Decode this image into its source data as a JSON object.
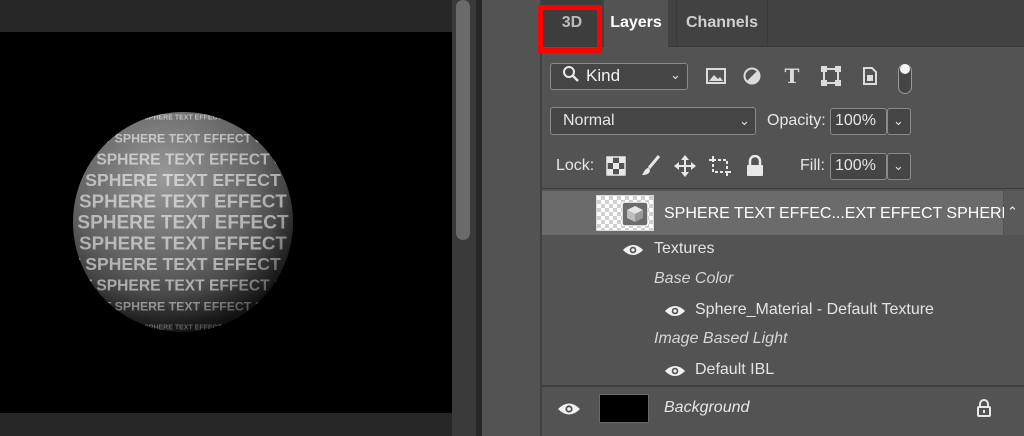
{
  "tabs": [
    {
      "label": "3D"
    },
    {
      "label": "Layers"
    },
    {
      "label": "Channels"
    }
  ],
  "highlight_color": "#ff0000",
  "filter": {
    "kind_label": "Kind",
    "icons": [
      "search-icon",
      "image-filter-icon",
      "adjustment-filter-icon",
      "type-filter-icon",
      "shape-filter-icon",
      "smart-object-filter-icon"
    ]
  },
  "blend_mode": "Normal",
  "opacity": {
    "label": "Opacity:",
    "value": "100%"
  },
  "lock": {
    "label": "Lock:",
    "icons": [
      "lock-transparent-pixels-icon",
      "lock-image-pixels-icon",
      "lock-position-icon",
      "lock-artboard-icon",
      "lock-all-icon"
    ]
  },
  "fill": {
    "label": "Fill:",
    "value": "100%"
  },
  "layers": {
    "sphere": {
      "name": "SPHERE TEXT EFFEC...EXT EFFECT SPHERE",
      "children": {
        "textures_label": "Textures",
        "base_color_label": "Base Color",
        "base_color_texture": "Sphere_Material - Default Texture",
        "ibl_label": "Image Based Light",
        "ibl_texture": "Default IBL"
      }
    },
    "background": {
      "name": "Background"
    }
  },
  "canvas": {
    "sphere_text": "SPHERE TEXT EFFECT"
  }
}
